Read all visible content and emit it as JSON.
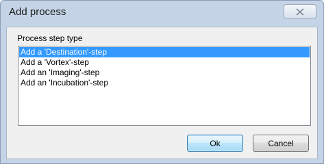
{
  "window": {
    "title": "Add process",
    "close_icon": "close-icon"
  },
  "group": {
    "label": "Process step type"
  },
  "list": {
    "items": [
      {
        "label": "Add a 'Destination'-step",
        "selected": true
      },
      {
        "label": "Add a 'Vortex'-step",
        "selected": false
      },
      {
        "label": "Add an 'Imaging'-step",
        "selected": false
      },
      {
        "label": "Add an 'Incubation'-step",
        "selected": false
      }
    ]
  },
  "buttons": {
    "ok_label": "Ok",
    "cancel_label": "Cancel"
  },
  "colors": {
    "selection": "#3399ff",
    "frame": "#c4d4e6"
  }
}
